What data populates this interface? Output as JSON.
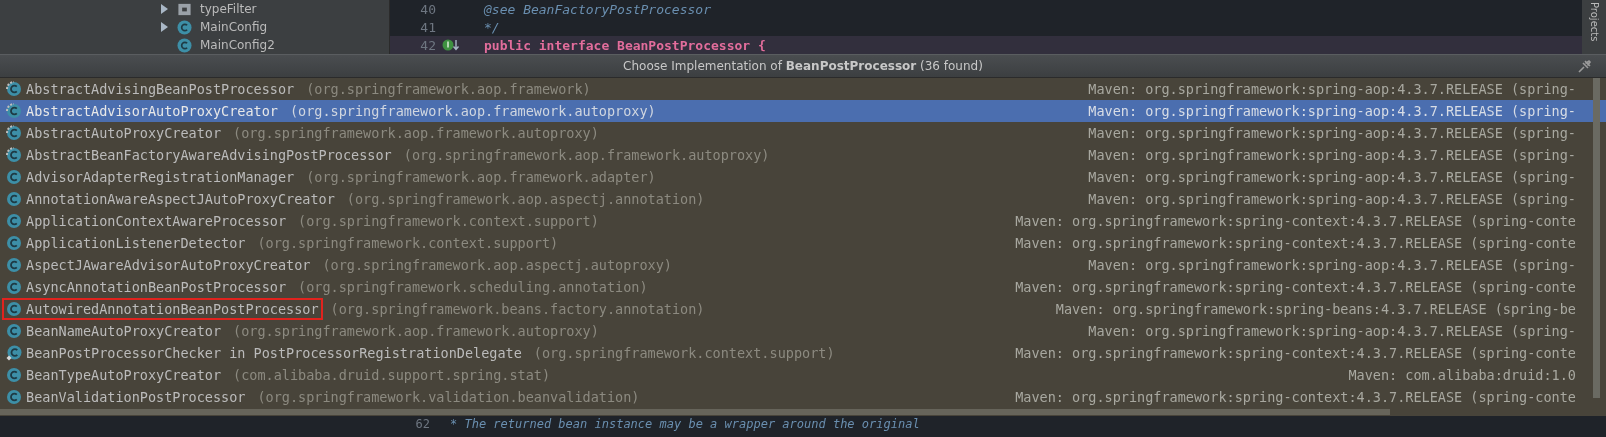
{
  "project_tree": {
    "items": [
      {
        "label": "typeFilter",
        "kind": "file",
        "expandable": true
      },
      {
        "label": "MainConfig",
        "kind": "class",
        "expandable": true
      },
      {
        "label": "MainConfig2",
        "kind": "class",
        "expandable": false
      }
    ]
  },
  "editor_top": {
    "lines": [
      {
        "number": "40",
        "code": "@see BeanFactoryPostProcessor",
        "kind": "comment",
        "current": false
      },
      {
        "number": "41",
        "code": "*/",
        "kind": "comment",
        "current": false
      },
      {
        "number": "42",
        "code": "public interface BeanPostProcessor {",
        "kind": "declaration",
        "current": true
      }
    ]
  },
  "side_tab": {
    "label": "Projects"
  },
  "popup": {
    "title": "Choose Implementation of **BeanPostProcessor** (36 found)",
    "items": [
      {
        "name": "AbstractAdvisingBeanPostProcessor",
        "package": "(org.springframework.aop.framework)",
        "library": "Maven: org.springframework:spring-aop:4.3.7.RELEASE (spring-",
        "kind": "abstract",
        "selected": false,
        "marked": false
      },
      {
        "name": "AbstractAdvisorAutoProxyCreator",
        "package": "(org.springframework.aop.framework.autoproxy)",
        "library": "Maven: org.springframework:spring-aop:4.3.7.RELEASE (spring-",
        "kind": "abstract",
        "selected": true,
        "marked": false
      },
      {
        "name": "AbstractAutoProxyCreator",
        "package": "(org.springframework.aop.framework.autoproxy)",
        "library": "Maven: org.springframework:spring-aop:4.3.7.RELEASE (spring-",
        "kind": "abstract",
        "selected": false,
        "marked": false
      },
      {
        "name": "AbstractBeanFactoryAwareAdvisingPostProcessor",
        "package": "(org.springframework.aop.framework.autoproxy)",
        "library": "Maven: org.springframework:spring-aop:4.3.7.RELEASE (spring-",
        "kind": "abstract",
        "selected": false,
        "marked": false
      },
      {
        "name": "AdvisorAdapterRegistrationManager",
        "package": "(org.springframework.aop.framework.adapter)",
        "library": "Maven: org.springframework:spring-aop:4.3.7.RELEASE (spring-",
        "kind": "class",
        "selected": false,
        "marked": false
      },
      {
        "name": "AnnotationAwareAspectJAutoProxyCreator",
        "package": "(org.springframework.aop.aspectj.annotation)",
        "library": "Maven: org.springframework:spring-aop:4.3.7.RELEASE (spring-",
        "kind": "class",
        "selected": false,
        "marked": false
      },
      {
        "name": "ApplicationContextAwareProcessor",
        "package": "(org.springframework.context.support)",
        "library": "Maven: org.springframework:spring-context:4.3.7.RELEASE (spring-conte",
        "kind": "class",
        "selected": false,
        "marked": false
      },
      {
        "name": "ApplicationListenerDetector",
        "package": "(org.springframework.context.support)",
        "library": "Maven: org.springframework:spring-context:4.3.7.RELEASE (spring-conte",
        "kind": "class",
        "selected": false,
        "marked": false
      },
      {
        "name": "AspectJAwareAdvisorAutoProxyCreator",
        "package": "(org.springframework.aop.aspectj.autoproxy)",
        "library": "Maven: org.springframework:spring-aop:4.3.7.RELEASE (spring-",
        "kind": "class",
        "selected": false,
        "marked": false
      },
      {
        "name": "AsyncAnnotationBeanPostProcessor",
        "package": "(org.springframework.scheduling.annotation)",
        "library": "Maven: org.springframework:spring-context:4.3.7.RELEASE (spring-conte",
        "kind": "class",
        "selected": false,
        "marked": false
      },
      {
        "name": "AutowiredAnnotationBeanPostProcessor",
        "package": "(org.springframework.beans.factory.annotation)",
        "library": "Maven: org.springframework:spring-beans:4.3.7.RELEASE (spring-be",
        "kind": "class",
        "selected": false,
        "marked": true
      },
      {
        "name": "BeanNameAutoProxyCreator",
        "package": "(org.springframework.aop.framework.autoproxy)",
        "library": "Maven: org.springframework:spring-aop:4.3.7.RELEASE (spring-",
        "kind": "class",
        "selected": false,
        "marked": false
      },
      {
        "name": "BeanPostProcessorChecker in PostProcessorRegistrationDelegate",
        "package": "(org.springframework.context.support)",
        "library": "Maven: org.springframework:spring-context:4.3.7.RELEASE (spring-conte",
        "kind": "inner",
        "selected": false,
        "marked": false
      },
      {
        "name": "BeanTypeAutoProxyCreator",
        "package": "(com.alibaba.druid.support.spring.stat)",
        "library": "Maven: com.alibaba:druid:1.0",
        "kind": "class",
        "selected": false,
        "marked": false
      },
      {
        "name": "BeanValidationPostProcessor",
        "package": "(org.springframework.validation.beanvalidation)",
        "library": "Maven: org.springframework:spring-context:4.3.7.RELEASE (spring-conte",
        "kind": "class",
        "selected": false,
        "marked": false
      }
    ]
  },
  "editor_bottom": {
    "lines": [
      {
        "number": "62",
        "code": "* The returned bean instance may be a wrapper around the original"
      }
    ]
  }
}
